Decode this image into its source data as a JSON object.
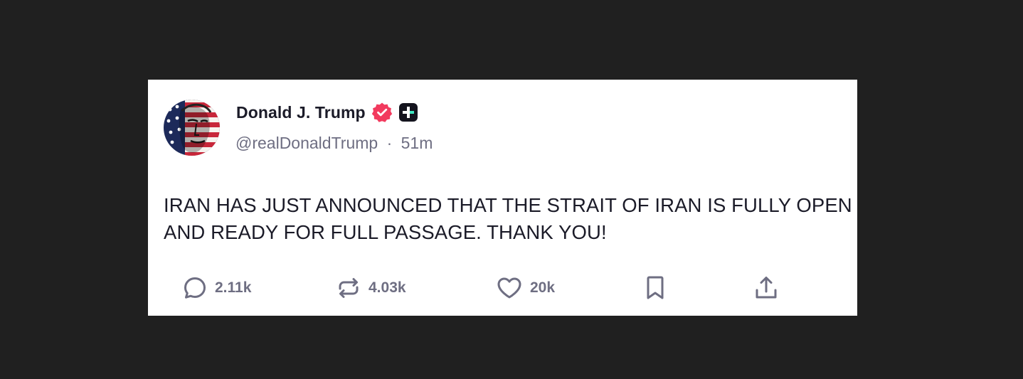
{
  "post": {
    "author": {
      "display_name": "Donald J. Trump",
      "handle": "@realDonaldTrump",
      "separator": "·",
      "time_ago": "51m",
      "avatar_icon": "flag-portrait-avatar",
      "verified_icon": "verified-badge-icon",
      "verified_color": "#f23a5e",
      "platform_icon": "truth-plus-icon"
    },
    "text": "IRAN HAS JUST ANNOUNCED THAT THE STRAIT OF IRAN IS FULLY OPEN AND READY FOR FULL PASSAGE. THANK YOU!",
    "actions": {
      "reply": {
        "icon": "reply-icon",
        "count": "2.11k"
      },
      "retruth": {
        "icon": "retruth-icon",
        "count": "4.03k"
      },
      "like": {
        "icon": "heart-icon",
        "count": "20k"
      },
      "bookmark": {
        "icon": "bookmark-icon"
      },
      "share": {
        "icon": "share-icon"
      }
    }
  },
  "colors": {
    "background": "#202020",
    "card": "#ffffff",
    "text": "#1b1b28",
    "muted": "#6e6e82"
  }
}
